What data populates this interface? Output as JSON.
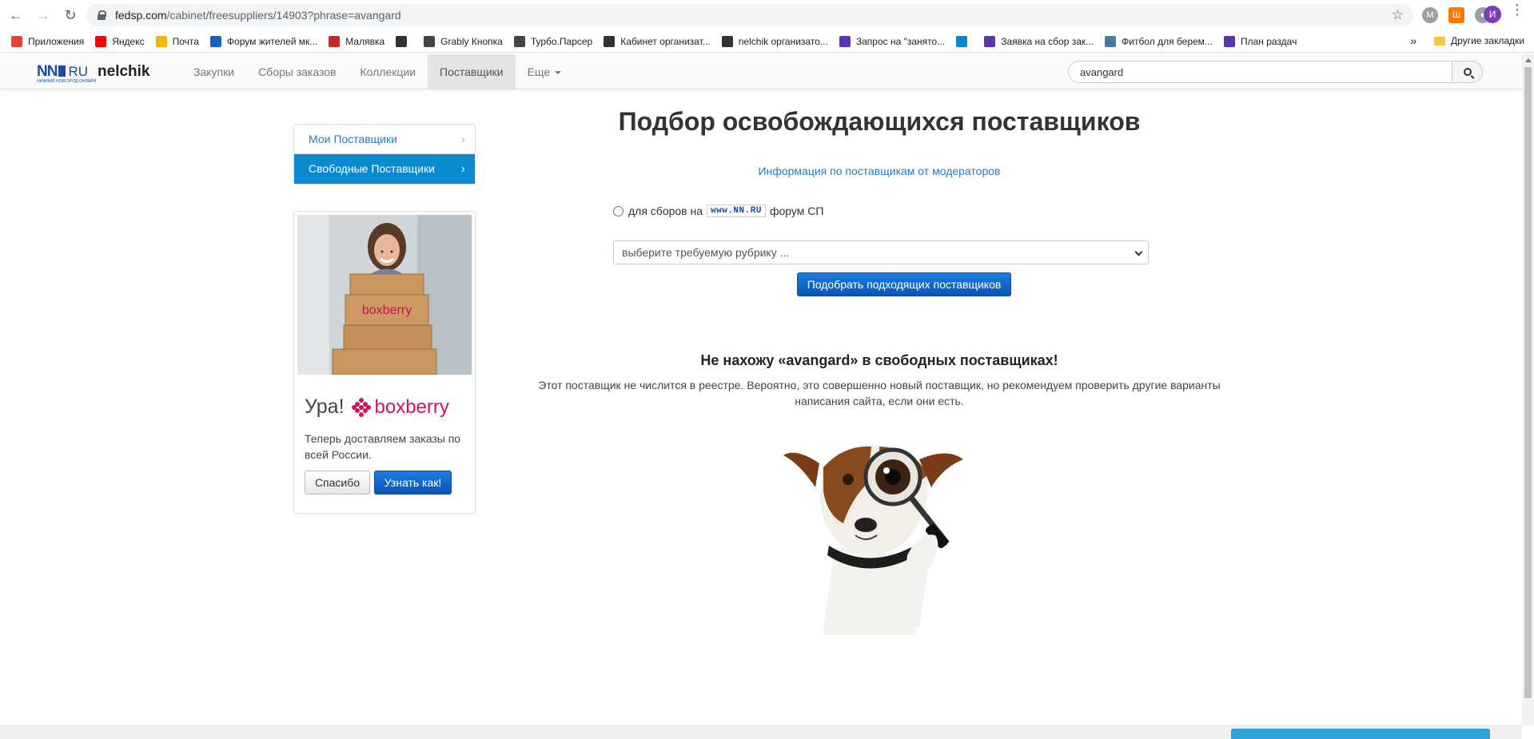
{
  "browser": {
    "url_host": "fedsp.com",
    "url_path": "/cabinet/freesuppliers/14903?phrase=avangard",
    "profile_initial": "И",
    "bookmarks": [
      {
        "label": "Приложения",
        "color": "#ea4335"
      },
      {
        "label": "Яндекс",
        "color": "#ff0000"
      },
      {
        "label": "Почта",
        "color": "#f4b400"
      },
      {
        "label": "Форум жителей мк...",
        "color": "#1565c0"
      },
      {
        "label": "Малявка",
        "color": "#c62828"
      },
      {
        "label": "",
        "color": "#333333"
      },
      {
        "label": "Grably Кнопка",
        "color": "#444444"
      },
      {
        "label": "Турбо.Парсер",
        "color": "#444444"
      },
      {
        "label": "Кабинет организат...",
        "color": "#333333"
      },
      {
        "label": "nelchik организато...",
        "color": "#333333"
      },
      {
        "label": "Запрос на \"занято...",
        "color": "#5e35b1"
      },
      {
        "label": "",
        "color": "#0288d1"
      },
      {
        "label": "Заявка на сбор зак...",
        "color": "#5e35b1"
      },
      {
        "label": "Фитбол для берем...",
        "color": "#4a76a8"
      },
      {
        "label": "План раздач",
        "color": "#5e35b1"
      }
    ],
    "more_bookmarks_label": "»",
    "other_bookmarks": "Другие закладки"
  },
  "site": {
    "brand_nn": "NN",
    "brand_ru": "RU",
    "brand_tagline": "НИЖНИЙ НОВГОРОД ОНЛАЙН",
    "username": "nelchik",
    "nav": [
      "Закупки",
      "Сборы заказов",
      "Коллекции",
      "Поставщики",
      "Еще"
    ],
    "active_nav": "Поставщики",
    "search_value": "avangard"
  },
  "sidebar": {
    "items": [
      {
        "label": "Мои Поставщики",
        "active": false
      },
      {
        "label": "Свободные Поставщики",
        "active": true
      }
    ]
  },
  "promo": {
    "title": "Ура!",
    "brand": "boxberry",
    "text": "Теперь доставляем заказы по всей России.",
    "thanks_label": "Спасибо",
    "learn_label": "Узнать как!"
  },
  "main": {
    "title": "Подбор освобождающихся поставщиков",
    "moderators_link": "Информация по поставщикам от модераторов",
    "radio_prefix": "для сборов на",
    "radio_badge": "www.NN.RU",
    "radio_suffix": "форум СП",
    "rubric_placeholder": "выберите требуемую рубрику ...",
    "pick_button": "Подобрать подходящих поставщиков",
    "not_found_title": "Не нахожу «avangard» в свободных поставщиках!",
    "not_found_text": "Этот поставщик не числится в реестре. Вероятно, это совершенно новый поставщик, но рекомендуем проверить другие варианты написания сайта, если они есть."
  },
  "colors": {
    "accent": "#0a8ad0",
    "link": "#2a7ab8",
    "button": "#0a55b5",
    "boxberry": "#d2145a"
  }
}
